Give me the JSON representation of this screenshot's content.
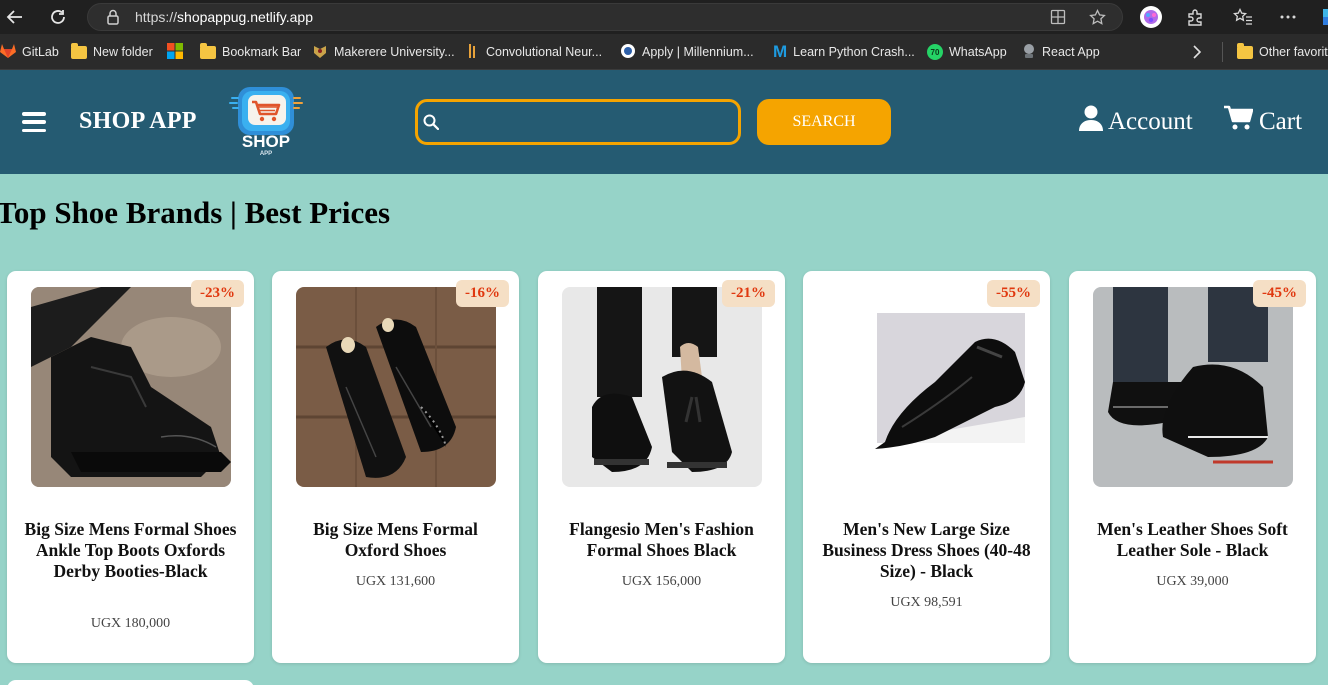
{
  "browser": {
    "url_prefix": "https://",
    "url_host": "shopappug.netlify.app",
    "bookmarks": [
      {
        "label": "GitLab",
        "icon": "gitlab-icon"
      },
      {
        "label": "New folder",
        "icon": "folder-icon"
      },
      {
        "label": "",
        "icon": "microsoft-icon"
      },
      {
        "label": "Bookmark Bar",
        "icon": "folder-icon"
      },
      {
        "label": "Makerere University...",
        "icon": "makerere-icon"
      },
      {
        "label": "Convolutional Neur...",
        "icon": "site-icon"
      },
      {
        "label": "Apply | Millennium...",
        "icon": "globe-icon"
      },
      {
        "label": "Learn Python Crash...",
        "icon": "m-logo-icon"
      },
      {
        "label": "WhatsApp",
        "icon": "whatsapp-icon"
      },
      {
        "label": "React App",
        "icon": "react-app-icon"
      },
      {
        "label": "Other favorite",
        "icon": "folder-icon"
      }
    ],
    "whatsapp_badge": "70",
    "colors": {
      "chrome": "#202020",
      "bookmark_bar": "#2b2b2b"
    }
  },
  "header": {
    "brand": "SHOP APP",
    "logo_text": "SHOP",
    "logo_subtext": "APP",
    "search_placeholder": "",
    "search_button": "SEARCH",
    "account_label": "Account",
    "cart_label": "Cart",
    "colors": {
      "background": "#255b72",
      "accent": "#f5a400"
    }
  },
  "main": {
    "section_title": "Top Shoe Brands | Best Prices",
    "background": "#96d3c8",
    "products": [
      {
        "name": "Big Size Mens Formal Shoes Ankle Top Boots Oxfords Derby Booties-Black",
        "price": "UGX 180,000",
        "discount": "-23%"
      },
      {
        "name": "Big Size Mens Formal Oxford Shoes",
        "price": "UGX 131,600",
        "discount": "-16%"
      },
      {
        "name": "Flangesio Men's Fashion Formal Shoes Black",
        "price": "UGX 156,000",
        "discount": "-21%"
      },
      {
        "name": "Men's New Large Size Business Dress Shoes (40-48 Size) - Black",
        "price": "UGX 98,591",
        "discount": "-55%"
      },
      {
        "name": "Men's Leather Shoes Soft Leather Sole - Black",
        "price": "UGX 39,000",
        "discount": "-45%"
      }
    ]
  }
}
